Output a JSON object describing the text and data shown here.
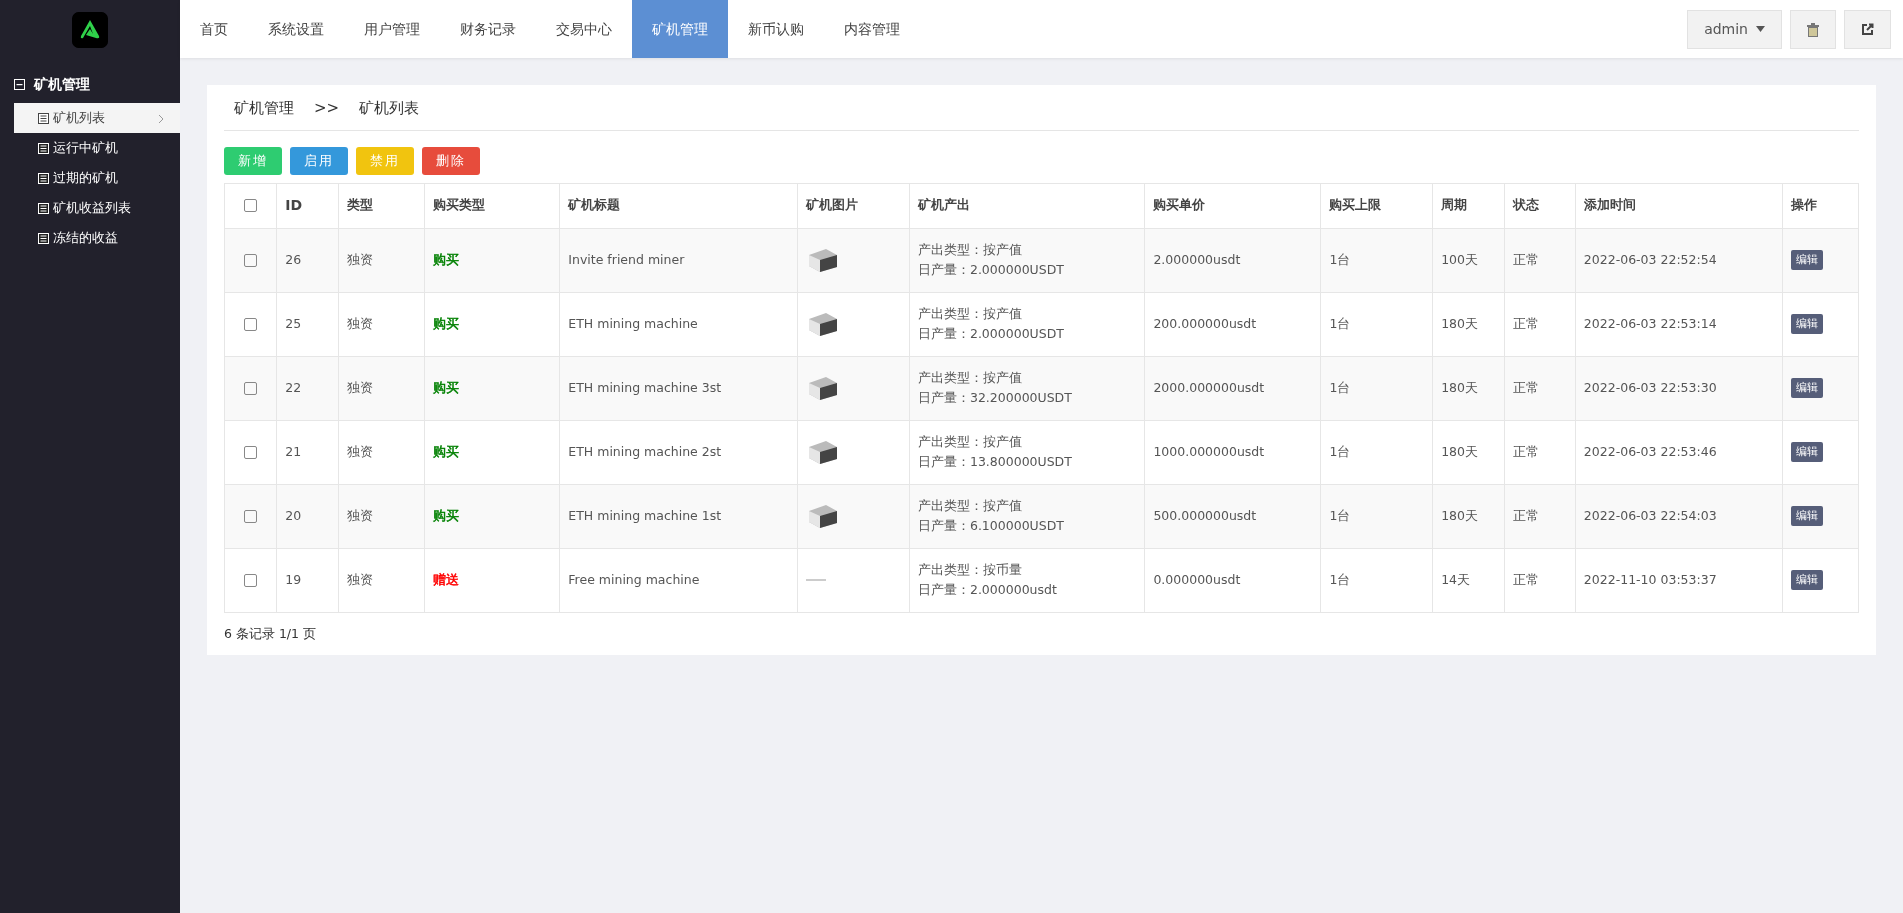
{
  "sidebar": {
    "group": {
      "label": "矿机管理",
      "expanded": true
    },
    "items": [
      {
        "label": "矿机列表",
        "selected": true
      },
      {
        "label": "运行中矿机",
        "selected": false
      },
      {
        "label": "过期的矿机",
        "selected": false
      },
      {
        "label": "矿机收益列表",
        "selected": false
      },
      {
        "label": "冻结的收益",
        "selected": false
      }
    ]
  },
  "tabs": [
    {
      "label": "首页",
      "selected": false
    },
    {
      "label": "系统设置",
      "selected": false
    },
    {
      "label": "用户管理",
      "selected": false
    },
    {
      "label": "财务记录",
      "selected": false
    },
    {
      "label": "交易中心",
      "selected": false
    },
    {
      "label": "矿机管理",
      "selected": true
    },
    {
      "label": "新币认购",
      "selected": false
    },
    {
      "label": "内容管理",
      "selected": false
    }
  ],
  "user_menu": {
    "label": "admin"
  },
  "breadcrumb": [
    "矿机管理",
    ">>",
    "矿机列表"
  ],
  "buttons": [
    {
      "label": "新增",
      "kind": "success"
    },
    {
      "label": "启用",
      "kind": "info"
    },
    {
      "label": "禁用",
      "kind": "warning"
    },
    {
      "label": "删除",
      "kind": "danger"
    }
  ],
  "table": {
    "select_all": {
      "checked": false
    },
    "columns": [
      "ID",
      "类型",
      "购买类型",
      "矿机标题",
      "矿机图片",
      "矿机产出",
      "购买单价",
      "购买上限",
      "周期",
      "状态",
      "添加时间",
      "操作"
    ],
    "rows": [
      {
        "checked": false,
        "id": "26",
        "type": "独资",
        "buy_type": {
          "text": "购买",
          "color": "#008000"
        },
        "title": "Invite friend miner",
        "image": {
          "kind": "photo"
        },
        "output_type": "产出类型：按产值",
        "daily_output": "日产量：2.000000USDT",
        "price": "2.000000usdt",
        "limit": "1台",
        "period": "100天",
        "status": "正常",
        "added": "2022-06-03 22:52:54",
        "action": "编辑"
      },
      {
        "checked": false,
        "id": "25",
        "type": "独资",
        "buy_type": {
          "text": "购买",
          "color": "#008000"
        },
        "title": "ETH mining machine",
        "image": {
          "kind": "photo"
        },
        "output_type": "产出类型：按产值",
        "daily_output": "日产量：2.000000USDT",
        "price": "200.000000usdt",
        "limit": "1台",
        "period": "180天",
        "status": "正常",
        "added": "2022-06-03 22:53:14",
        "action": "编辑"
      },
      {
        "checked": false,
        "id": "22",
        "type": "独资",
        "buy_type": {
          "text": "购买",
          "color": "#008000"
        },
        "title": "ETH mining machine 3st",
        "image": {
          "kind": "photo"
        },
        "output_type": "产出类型：按产值",
        "daily_output": "日产量：32.200000USDT",
        "price": "2000.000000usdt",
        "limit": "1台",
        "period": "180天",
        "status": "正常",
        "added": "2022-06-03 22:53:30",
        "action": "编辑"
      },
      {
        "checked": false,
        "id": "21",
        "type": "独资",
        "buy_type": {
          "text": "购买",
          "color": "#008000"
        },
        "title": "ETH mining machine 2st",
        "image": {
          "kind": "photo"
        },
        "output_type": "产出类型：按产值",
        "daily_output": "日产量：13.800000USDT",
        "price": "1000.000000usdt",
        "limit": "1台",
        "period": "180天",
        "status": "正常",
        "added": "2022-06-03 22:53:46",
        "action": "编辑"
      },
      {
        "checked": false,
        "id": "20",
        "type": "独资",
        "buy_type": {
          "text": "购买",
          "color": "#008000"
        },
        "title": "ETH mining machine 1st",
        "image": {
          "kind": "photo"
        },
        "output_type": "产出类型：按产值",
        "daily_output": "日产量：6.100000USDT",
        "price": "500.000000usdt",
        "limit": "1台",
        "period": "180天",
        "status": "正常",
        "added": "2022-06-03 22:54:03",
        "action": "编辑"
      },
      {
        "checked": false,
        "id": "19",
        "type": "独资",
        "buy_type": {
          "text": "赠送",
          "color": "#ff0000"
        },
        "title": "Free mining machine",
        "image": {
          "kind": "broken"
        },
        "output_type": "产出类型：按币量",
        "daily_output": "日产量：2.000000usdt",
        "price": "0.000000usdt",
        "limit": "1台",
        "period": "14天",
        "status": "正常",
        "added": "2022-11-10 03:53:37",
        "action": "编辑"
      }
    ]
  },
  "pagination": "6 条记录 1/1 页"
}
